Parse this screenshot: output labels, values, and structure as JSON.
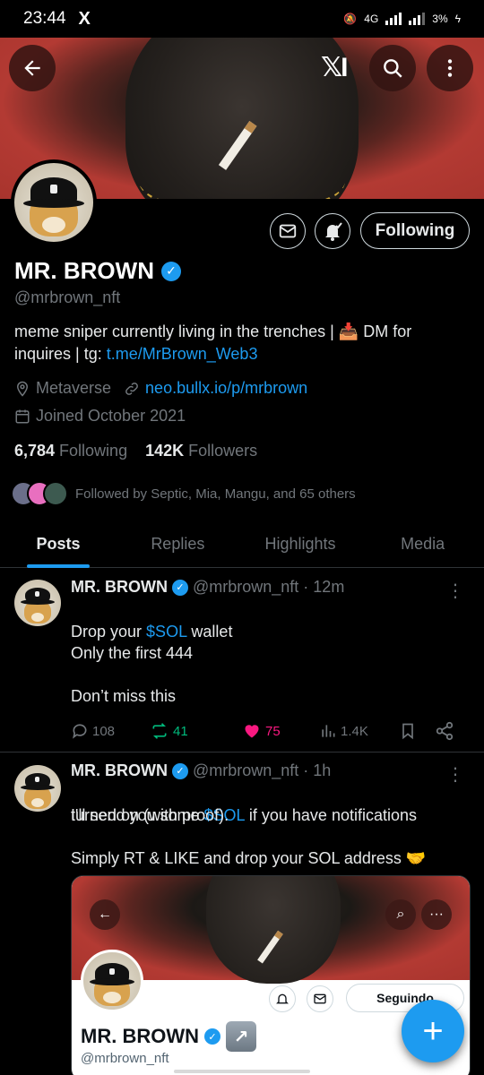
{
  "status": {
    "time": "23:44",
    "app_icon": "X",
    "network": "4G",
    "battery": "3%"
  },
  "banner": {
    "back_icon": "arrow-left-icon",
    "logo": "x-logo",
    "search_icon": "search-icon",
    "more_icon": "more-vertical-icon"
  },
  "profile": {
    "name": "MR. BROWN",
    "handle": "@mrbrown_nft",
    "bio_part1": "meme sniper currently living in the trenches | ",
    "bio_emoji": "📥",
    "bio_part2": " DM for inquires | tg: ",
    "bio_link": "t.me/MrBrown_Web3",
    "location": "Metaverse",
    "website": "neo.bullx.io/p/mrbrown",
    "joined": "Joined October 2021",
    "following_count": "6,784",
    "following_label": "Following",
    "followers_count": "142K",
    "followers_label": "Followers",
    "followed_by": "Followed by Septic, Mia, Mangu, and 65 others",
    "follow_button": "Following"
  },
  "tabs": [
    "Posts",
    "Replies",
    "Highlights",
    "Media"
  ],
  "posts": [
    {
      "name": "MR. BROWN",
      "handle": "@mrbrown_nft",
      "time": "· 12m",
      "line1_pre": "Drop your ",
      "line1_tag": "$SOL",
      "line1_post": " wallet",
      "body": "Only the first 444\n\nDon’t miss this",
      "replies": "108",
      "reposts": "41",
      "likes": "75",
      "views": "1.4K"
    },
    {
      "name": "MR. BROWN",
      "handle": "@mrbrown_nft",
      "time": "· 1h",
      "line1_pre": "I'll send you some ",
      "line1_tag": "$SOL",
      "line1_post": " if you have notifications",
      "line2": "turned on (with proof).",
      "line3": "Simply RT & LIKE and drop your SOL address 🤝"
    }
  ],
  "embedded_card": {
    "name": "MR. BROWN",
    "handle": "@mrbrown_nft",
    "follow_button": "Seguindo",
    "arrow": "↗"
  },
  "fab": "+",
  "colors": {
    "accent": "#1d9bf0",
    "like": "#f91880",
    "repost": "#00ba7c",
    "muted": "#71767b"
  }
}
